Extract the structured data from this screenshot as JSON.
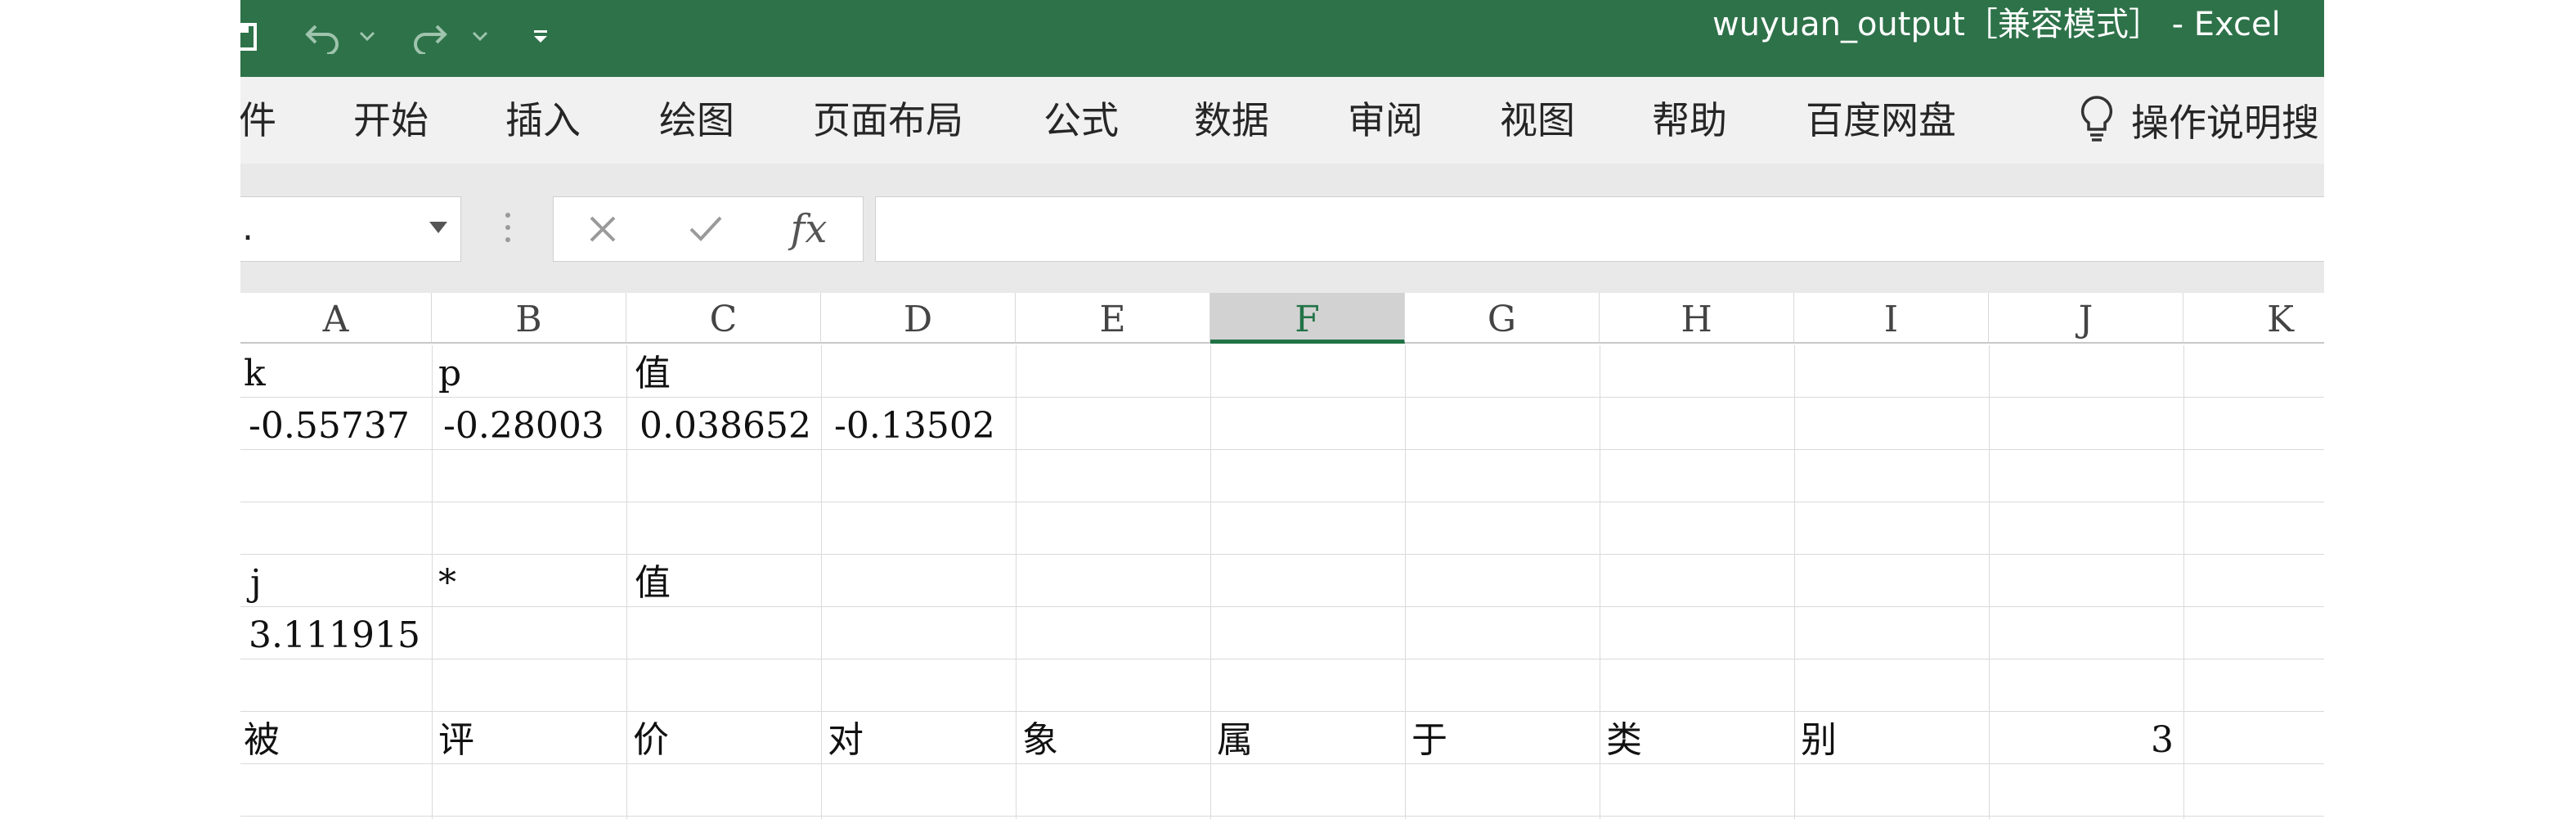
{
  "window": {
    "title": "wuyuan_output［兼容模式］ - Excel"
  },
  "colors": {
    "title_bar": "#2e7249",
    "ribbon": "#f1f1f1",
    "selection_accent": "#217346"
  },
  "quick_access": {
    "icons": [
      "save-icon",
      "undo-icon",
      "dropdown-icon",
      "redo-icon",
      "dropdown-icon",
      "customize-icon"
    ]
  },
  "ribbon": {
    "tabs": [
      "件",
      "开始",
      "插入",
      "绘图",
      "页面布局",
      "公式",
      "数据",
      "审阅",
      "视图",
      "帮助",
      "百度网盘"
    ],
    "tell_me": "操作说明搜"
  },
  "formula_bar": {
    "name_box_value": ".",
    "fx_label": "fx",
    "formula": ""
  },
  "columns": [
    "A",
    "B",
    "C",
    "D",
    "E",
    "F",
    "G",
    "H",
    "I",
    "J",
    "K"
  ],
  "selected_column": "F",
  "cells": {
    "r1": {
      "A": "k",
      "B": "p",
      "C": "值"
    },
    "r2": {
      "A": "-0.55737",
      "B": "-0.28003",
      "C": "0.038652",
      "D": "-0.13502"
    },
    "r5": {
      "A": "j",
      "B": "*",
      "C": "值"
    },
    "r6": {
      "A": "3.111915"
    },
    "r8": {
      "A": "被",
      "B": "评",
      "C": "价",
      "D": "对",
      "E": "象",
      "F": "属",
      "G": "于",
      "H": "类",
      "I": "别",
      "J": "3"
    }
  }
}
